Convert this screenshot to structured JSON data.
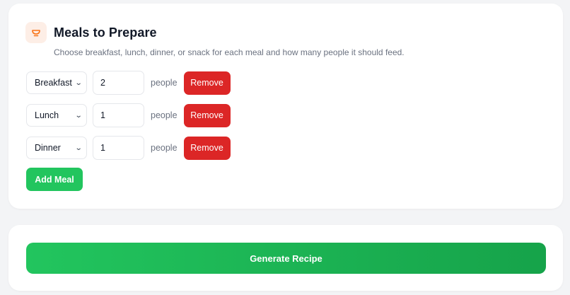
{
  "meals_section": {
    "title": "Meals to Prepare",
    "icon": "bowl-icon",
    "accent_color": "#f97316",
    "subtitle": "Choose breakfast, lunch, dinner, or snack for each meal and how many people it should feed.",
    "rows": [
      {
        "meal_type": "Breakfast",
        "count": "2",
        "unit": "people",
        "remove_label": "Remove"
      },
      {
        "meal_type": "Lunch",
        "count": "1",
        "unit": "people",
        "remove_label": "Remove"
      },
      {
        "meal_type": "Dinner",
        "count": "1",
        "unit": "people",
        "remove_label": "Remove"
      }
    ],
    "add_label": "Add Meal",
    "add_color": "#22c55e",
    "remove_color": "#dc2626"
  },
  "generate": {
    "label": "Generate Recipe",
    "color": "#16a34a"
  }
}
